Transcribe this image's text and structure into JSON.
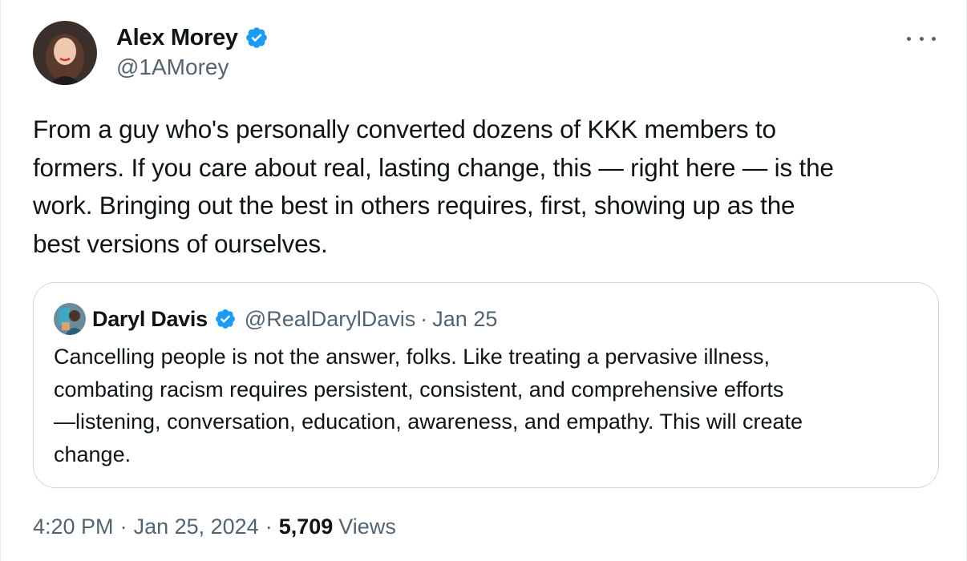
{
  "author": {
    "name": "Alex Morey",
    "handle": "@1AMorey",
    "verified_color": "#1d9bf0"
  },
  "more_menu": {
    "icon": "more-horizontal-icon"
  },
  "tweet": {
    "text": "From a guy who's personally converted dozens of KKK members to\nformers. If you care about real, lasting change, this — right here — is the\nwork. Bringing out the best in others requires, first, showing up as the\nbest versions of ourselves."
  },
  "quote": {
    "name": "Daryl Davis",
    "handle": "@RealDarylDavis",
    "separator": "·",
    "date": "Jan 25",
    "text": "Cancelling people is not the answer, folks. Like treating a pervasive illness,\ncombating racism requires persistent, consistent, and comprehensive efforts\n—listening, conversation, education, awareness, and empathy. This will create\nchange."
  },
  "meta": {
    "time": "4:20 PM",
    "separator": "·",
    "date": "Jan 25, 2024",
    "views_count": "5,709",
    "views_label": "Views"
  }
}
